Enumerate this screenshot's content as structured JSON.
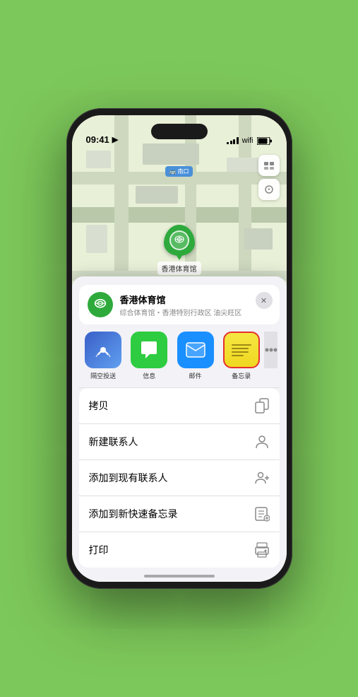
{
  "status_bar": {
    "time": "09:41",
    "location_arrow": "▶"
  },
  "map": {
    "label": "南口",
    "map_type_icon": "🗺",
    "location_icon": "◎"
  },
  "location_card": {
    "name": "香港体育馆",
    "description": "综合体育馆・香港特别行政区 油尖旺区",
    "close_label": "✕"
  },
  "app_icons": [
    {
      "id": "airdrop",
      "label": "隔空投送",
      "type": "airdrop"
    },
    {
      "id": "messages",
      "label": "信息",
      "type": "messages"
    },
    {
      "id": "mail",
      "label": "邮件",
      "type": "mail"
    },
    {
      "id": "notes",
      "label": "备忘录",
      "type": "notes"
    },
    {
      "id": "more",
      "label": "更多",
      "type": "more"
    }
  ],
  "actions": [
    {
      "id": "copy",
      "label": "拷贝",
      "icon": "copy"
    },
    {
      "id": "new-contact",
      "label": "新建联系人",
      "icon": "person"
    },
    {
      "id": "add-existing",
      "label": "添加到现有联系人",
      "icon": "person-add"
    },
    {
      "id": "add-notes",
      "label": "添加到新快速备忘录",
      "icon": "note"
    },
    {
      "id": "print",
      "label": "打印",
      "icon": "print"
    }
  ]
}
